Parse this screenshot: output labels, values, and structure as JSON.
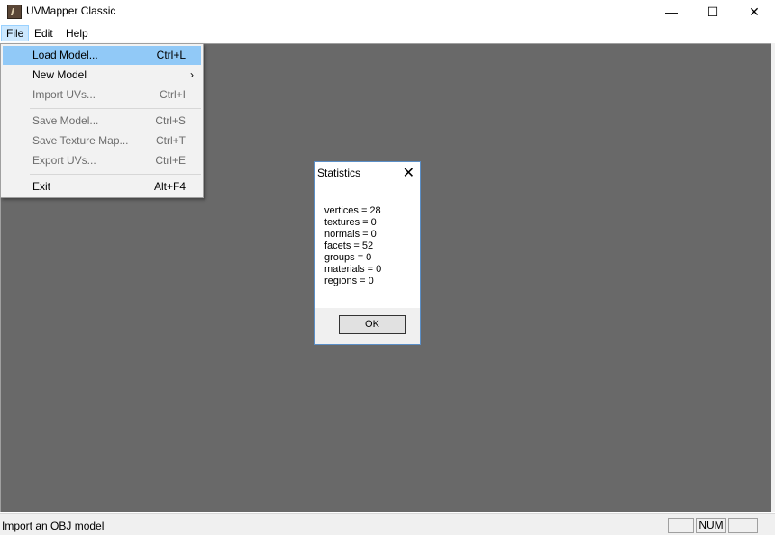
{
  "window": {
    "title": "UVMapper Classic",
    "icon": "uvmapper-app-icon",
    "controls": {
      "minimize": "—",
      "maximize": "☐",
      "close": "✕"
    }
  },
  "menubar": {
    "items": [
      {
        "label": "File",
        "active": true
      },
      {
        "label": "Edit"
      },
      {
        "label": "Help"
      }
    ]
  },
  "file_menu": {
    "items": [
      {
        "label": "Load Model...",
        "shortcut": "Ctrl+L",
        "highlighted": true
      },
      {
        "label": "New Model",
        "submenu_arrow": "›"
      },
      {
        "label": "Import UVs...",
        "shortcut": "Ctrl+I",
        "disabled": true
      },
      {
        "label": "Save Model...",
        "shortcut": "Ctrl+S",
        "disabled": true
      },
      {
        "label": "Save Texture Map...",
        "shortcut": "Ctrl+T",
        "disabled": true
      },
      {
        "label": "Export UVs...",
        "shortcut": "Ctrl+E",
        "disabled": true
      },
      {
        "label": "Exit",
        "shortcut": "Alt+F4"
      }
    ]
  },
  "dialog": {
    "title": "Statistics",
    "close": "✕",
    "lines": [
      "vertices = 28",
      "textures = 0",
      "normals = 0",
      "facets = 52",
      "groups = 0",
      "materials = 0",
      "regions = 0"
    ],
    "ok_label": "OK"
  },
  "statusbar": {
    "text": "Import an OBJ model",
    "panes": [
      "",
      "NUM",
      ""
    ]
  },
  "colors": {
    "workspace": "#696969",
    "menu_highlight": "#91c9f7",
    "dialog_border": "#5b8fc7"
  }
}
